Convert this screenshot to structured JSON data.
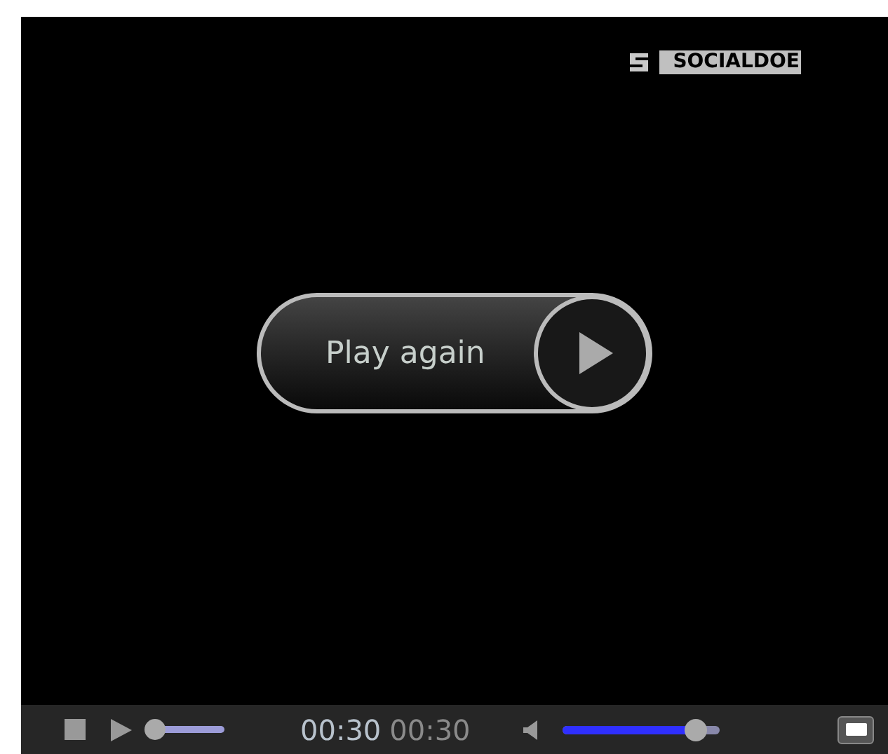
{
  "logo": {
    "text": "SOCIALDOE"
  },
  "overlay_button": {
    "label": "Play again"
  },
  "controls": {
    "progress": {
      "level": 0.05
    },
    "elapsed": "00:30",
    "duration": "00:30",
    "volume": {
      "level": 0.85
    }
  }
}
